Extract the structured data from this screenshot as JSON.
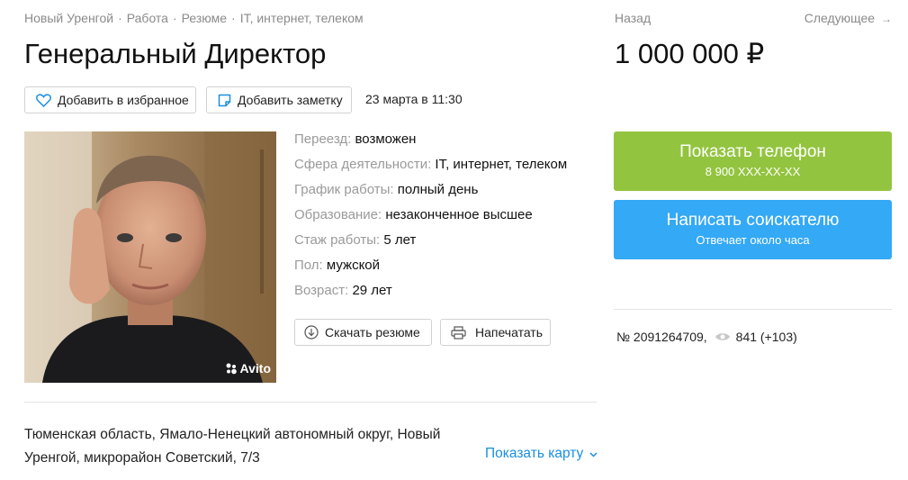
{
  "breadcrumbs": [
    "Новый Уренгой",
    "Работа",
    "Резюме",
    "IT, интернет, телеком"
  ],
  "breadcrumb_separator": "·",
  "title": "Генеральный Директор",
  "actions": {
    "favorite_label": "Добавить в избранное",
    "note_label": "Добавить заметку",
    "date": "23 марта в 11:30"
  },
  "photo": {
    "watermark": "Avito"
  },
  "params": [
    {
      "key": "Переезд:",
      "value": "возможен"
    },
    {
      "key": "Сфера деятельности:",
      "value": "IT, интернет, телеком"
    },
    {
      "key": "График работы:",
      "value": "полный день"
    },
    {
      "key": "Образование:",
      "value": "незаконченное высшее"
    },
    {
      "key": "Стаж работы:",
      "value": "5 лет"
    },
    {
      "key": "Пол:",
      "value": "мужской"
    },
    {
      "key": "Возраст:",
      "value": "29 лет"
    }
  ],
  "resume_actions": {
    "download_label": "Скачать резюме",
    "print_label": "Напечатать"
  },
  "address": "Тюменская область, Ямало-Ненецкий автономный округ, Новый Уренгой, микрорайон Советский, 7/3",
  "map_link": "Показать карту",
  "nav": {
    "back": "Назад",
    "next": "Следующее",
    "next_arrow": "→"
  },
  "price": "1 000 000 ₽",
  "phone_button": {
    "label": "Показать телефон",
    "sub": "8 900 XXX-XX-XX",
    "color": "#93c43f"
  },
  "message_button": {
    "label": "Написать соискателю",
    "sub": "Отвечает около часа",
    "color": "#34a9f5"
  },
  "meta": {
    "number": "№ 2091264709,",
    "views": "841 (+103)"
  },
  "colors": {
    "link": "#1a8fdf",
    "muted": "#8a8a8a"
  }
}
